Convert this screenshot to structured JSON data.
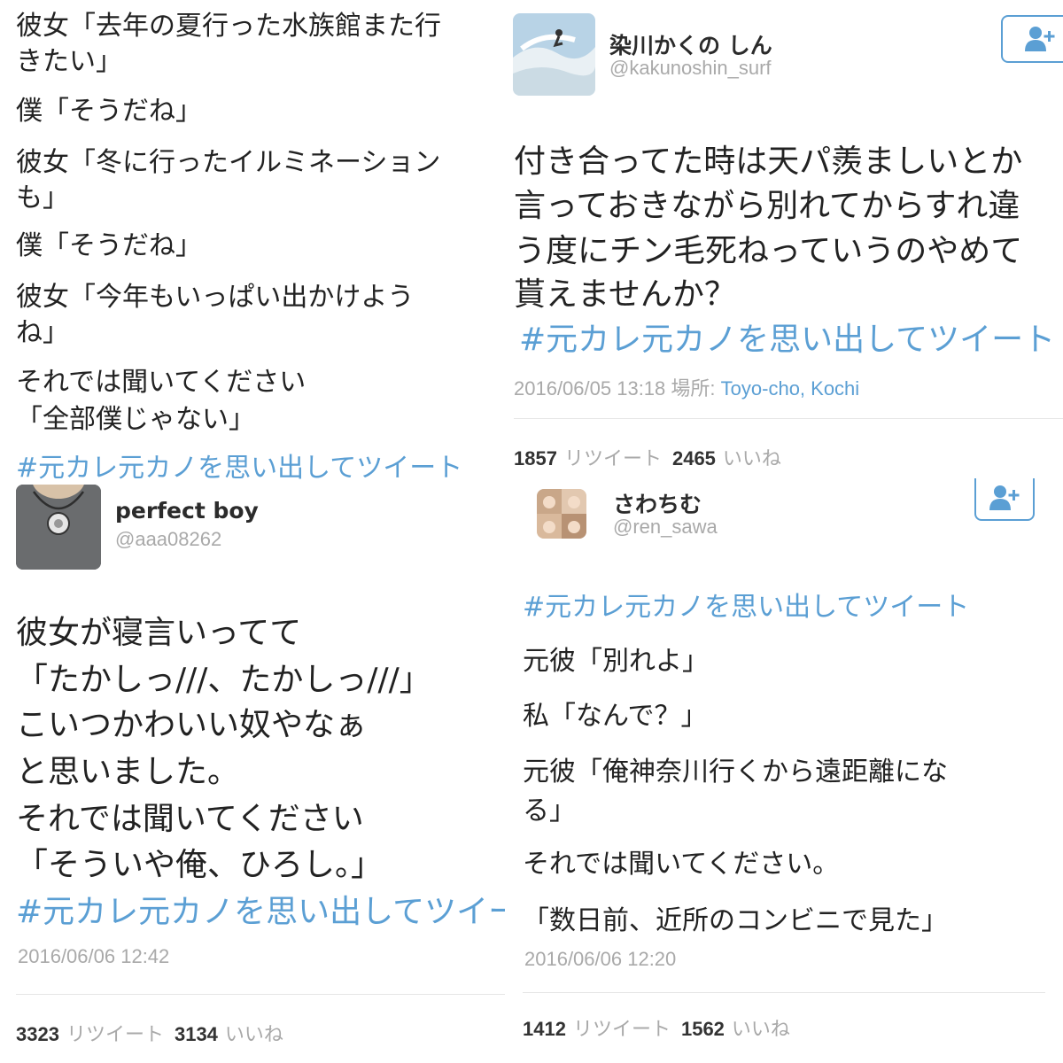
{
  "tweet_top_left": {
    "lines": [
      "彼女「去年の夏行った水族館また行",
      "きたい」",
      "僕「そうだね」",
      "彼女「冬に行ったイルミネーション",
      "も」",
      "僕「そうだね」",
      "彼女「今年もいっぱい出かけよう",
      "ね」",
      "それでは聞いてください",
      "「全部僕じゃない」"
    ],
    "hashtag": "#元カレ元カノを思い出してツイート"
  },
  "tweet_bottom_left": {
    "user": {
      "name": "perfect boy",
      "handle": "@aaa08262"
    },
    "lines": [
      "彼女が寝言いってて",
      "「たかしっ///、たかしっ///」",
      "こいつかわいい奴やなぁ",
      "と思いました。",
      "それでは聞いてください",
      "「そういや俺、ひろし。」"
    ],
    "hashtag": "#元カレ元カノを思い出してツイート",
    "timestamp": "2016/06/06 12:42",
    "retweets": "3323",
    "retweets_label": "リツイート",
    "likes": "3134",
    "likes_label": "いいね"
  },
  "tweet_top_right": {
    "user": {
      "name": "染川かくの しん",
      "handle": "@kakunoshin_surf"
    },
    "lines": [
      "付き合ってた時は天パ羨ましいとか",
      "言っておきながら別れてからすれ違",
      "う度にチン毛死ねっていうのやめて",
      "貰えませんか？"
    ],
    "hashtag": "#元カレ元カノを思い出してツイート",
    "timestamp": "2016/06/05 13:18",
    "location_label": "場所:",
    "location": "Toyo-cho, Kochi",
    "retweets": "1857",
    "retweets_label": "リツイート",
    "likes": "2465",
    "likes_label": "いいね"
  },
  "tweet_bottom_right": {
    "user": {
      "name": "さわちむ",
      "handle": "@ren_sawa"
    },
    "hashtag": "#元カレ元カノを思い出してツイート",
    "lines": [
      "元彼「別れよ」",
      "私「なんで？」",
      "元彼「俺神奈川行くから遠距離にな",
      "る」",
      "それでは聞いてください。",
      "「数日前、近所のコンビニで見た」"
    ],
    "timestamp": "2016/06/06 12:20",
    "retweets": "1412",
    "retweets_label": "リツイート",
    "likes": "1562",
    "likes_label": "いいね"
  },
  "colors": {
    "link": "#5b9fd4",
    "meta": "#a9a9a9",
    "text": "#222222"
  },
  "icons": {
    "follow": "add-user-icon"
  }
}
